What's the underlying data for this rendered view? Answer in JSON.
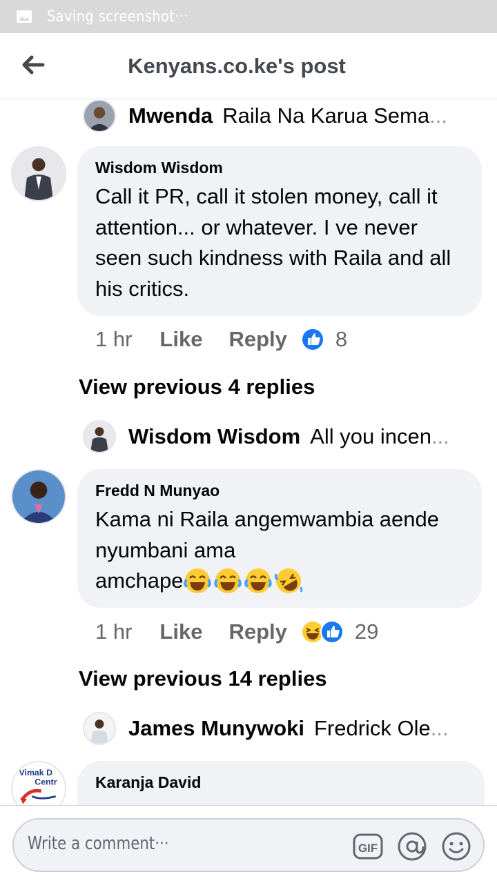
{
  "status_bar": {
    "text": "Saving screenshot···"
  },
  "header": {
    "title": "Kenyans.co.ke's post"
  },
  "collapsed_replies": [
    {
      "name": "Mwenda",
      "text": "Raila Na Karua Sema"
    },
    {
      "name": "Wisdom Wisdom",
      "text": "All you incen"
    },
    {
      "name": "James Munywoki",
      "text": "Fredrick Ole"
    }
  ],
  "ellipsis": "...",
  "comments": [
    {
      "name": "Wisdom Wisdom",
      "text": "Call it PR, call it stolen money, call it attention... or whatever. I ve never seen such kindness with Raila and all his critics.",
      "time": "1 hr",
      "like_label": "Like",
      "reply_label": "Reply",
      "reaction_count": "8",
      "reactions": [
        "like-icon"
      ]
    },
    {
      "name": "Fredd N Munyao",
      "text_lines": [
        "Kama ni Raila angemwambia aende",
        "nyumbani ama",
        "amchape"
      ],
      "emojis": [
        "tears-of-joy-icon",
        "tears-of-joy-icon",
        "tears-of-joy-icon",
        "rolling-laughing-icon"
      ],
      "time": "1 hr",
      "like_label": "Like",
      "reply_label": "Reply",
      "reaction_count": "29",
      "reactions": [
        "haha-icon",
        "like-icon"
      ]
    },
    {
      "name": "Karanja David",
      "avatar_text": [
        "Vimak D",
        "Centr"
      ]
    }
  ],
  "view_previous": [
    "View previous 4 replies",
    "View previous 14 replies"
  ],
  "composer": {
    "placeholder": "Write a comment···",
    "gif_label": "GIF"
  },
  "colors": {
    "like_blue": "#1877f2",
    "bubble_bg": "#f0f2f5",
    "muted_text": "#65676b",
    "status_bar_bg": "#d9d9d9"
  }
}
